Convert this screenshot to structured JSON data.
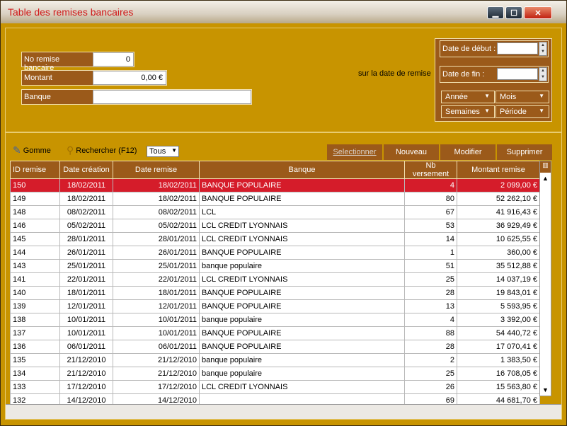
{
  "window": {
    "title": "Table des remises bancaires"
  },
  "form": {
    "no_remise_label": "No remise bancaire",
    "no_remise_value": "0",
    "montant_label": "Montant",
    "montant_value": "0,00 €",
    "banque_label": "Banque",
    "banque_value": "",
    "date_note": "sur la date de remise"
  },
  "dates": {
    "debut_label": "Date de début :",
    "fin_label": "Date de fin :",
    "annee": "Année",
    "mois": "Mois",
    "semaines": "Semaines",
    "periode": "Période"
  },
  "toolbar": {
    "gomme": "Gomme",
    "rechercher": "Rechercher (F12)",
    "filter_value": "Tous",
    "selectionner": "Selectionner",
    "nouveau": "Nouveau",
    "modifier": "Modifier",
    "supprimer": "Supprimer"
  },
  "table": {
    "headers": [
      "ID remise",
      "Date création",
      "Date remise",
      "Banque",
      "Nb versement",
      "Montant remise"
    ],
    "rows": [
      [
        "150",
        "18/02/2011",
        "18/02/2011",
        "BANQUE POPULAIRE",
        "4",
        "2 099,00 €"
      ],
      [
        "149",
        "18/02/2011",
        "18/02/2011",
        "BANQUE POPULAIRE",
        "80",
        "52 262,10 €"
      ],
      [
        "148",
        "08/02/2011",
        "08/02/2011",
        "LCL",
        "67",
        "41 916,43 €"
      ],
      [
        "146",
        "05/02/2011",
        "05/02/2011",
        "LCL CREDIT LYONNAIS",
        "53",
        "36 929,49 €"
      ],
      [
        "145",
        "28/01/2011",
        "28/01/2011",
        "LCL CREDIT LYONNAIS",
        "14",
        "10 625,55 €"
      ],
      [
        "144",
        "26/01/2011",
        "26/01/2011",
        "BANQUE POPULAIRE",
        "1",
        "360,00 €"
      ],
      [
        "143",
        "25/01/2011",
        "25/01/2011",
        "banque populaire",
        "51",
        "35 512,88 €"
      ],
      [
        "141",
        "22/01/2011",
        "22/01/2011",
        "LCL CREDIT LYONNAIS",
        "25",
        "14 037,19 €"
      ],
      [
        "140",
        "18/01/2011",
        "18/01/2011",
        "BANQUE POPULAIRE",
        "28",
        "19 843,01 €"
      ],
      [
        "139",
        "12/01/2011",
        "12/01/2011",
        "BANQUE POPULAIRE",
        "13",
        "5 593,95 €"
      ],
      [
        "138",
        "10/01/2011",
        "10/01/2011",
        "banque populaire",
        "4",
        "3 392,00 €"
      ],
      [
        "137",
        "10/01/2011",
        "10/01/2011",
        "BANQUE POPULAIRE",
        "88",
        "54 440,72 €"
      ],
      [
        "136",
        "06/01/2011",
        "06/01/2011",
        "BANQUE POPULAIRE",
        "28",
        "17 070,41 €"
      ],
      [
        "135",
        "21/12/2010",
        "21/12/2010",
        "banque populaire",
        "2",
        "1 383,50 €"
      ],
      [
        "134",
        "21/12/2010",
        "21/12/2010",
        "banque populaire",
        "25",
        "16 708,05 €"
      ],
      [
        "133",
        "17/12/2010",
        "17/12/2010",
        "LCL CREDIT LYONNAIS",
        "26",
        "15 563,80 €"
      ],
      [
        "132",
        "14/12/2010",
        "14/12/2010",
        "",
        "69",
        "44 681,70 €"
      ]
    ]
  }
}
